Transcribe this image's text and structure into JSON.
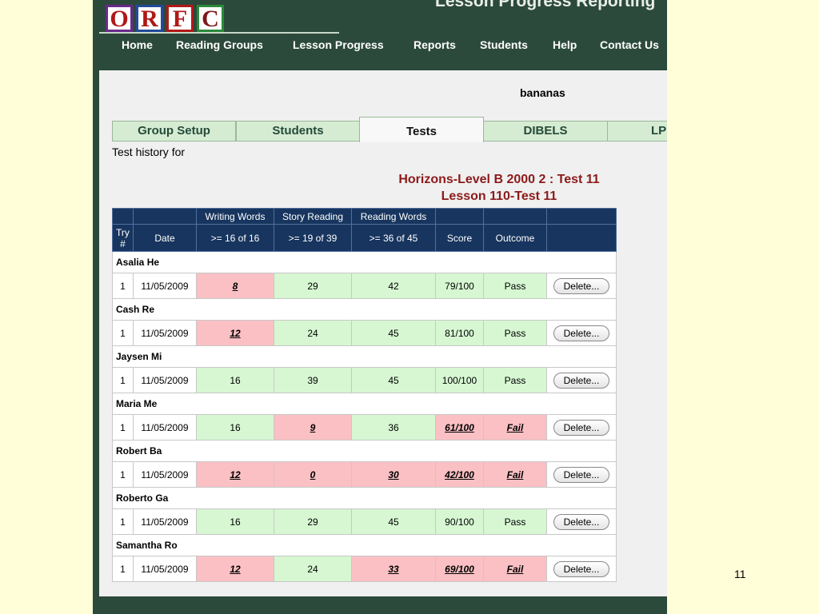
{
  "logo_letters": [
    "O",
    "R",
    "F",
    "C"
  ],
  "app_title": "Lesson Progress Reporting",
  "nav": [
    "Home",
    "Reading Groups",
    "Lesson Progress",
    "Reports",
    "Students",
    "Help",
    "Contact Us"
  ],
  "group_name": "bananas",
  "tabs": [
    "Group Setup",
    "Students",
    "Tests",
    "DIBELS",
    "LPR"
  ],
  "active_tab": "Tests",
  "history_label": "Test history for",
  "test_title": [
    "Horizons-Level B 2000 2 : Test 11",
    "Lesson 110-Test 11"
  ],
  "table": {
    "group_headers": [
      "Writing Words",
      "Story Reading",
      "Reading Words"
    ],
    "headers": [
      "Try #",
      "Date",
      ">= 16 of 16",
      ">= 19 of 39",
      ">= 36 of 45",
      "Score",
      "Outcome"
    ],
    "delete_label": "Delete...",
    "students": [
      {
        "name": "Asalia He",
        "try": "1",
        "date": "11/05/2009",
        "writing": "8",
        "writing_pass": false,
        "story": "29",
        "story_pass": true,
        "reading": "42",
        "reading_pass": true,
        "score": "79/100",
        "score_pass": true,
        "outcome": "Pass"
      },
      {
        "name": "Cash Re",
        "try": "1",
        "date": "11/05/2009",
        "writing": "12",
        "writing_pass": false,
        "story": "24",
        "story_pass": true,
        "reading": "45",
        "reading_pass": true,
        "score": "81/100",
        "score_pass": true,
        "outcome": "Pass"
      },
      {
        "name": "Jaysen Mi",
        "try": "1",
        "date": "11/05/2009",
        "writing": "16",
        "writing_pass": true,
        "story": "39",
        "story_pass": true,
        "reading": "45",
        "reading_pass": true,
        "score": "100/100",
        "score_pass": true,
        "outcome": "Pass"
      },
      {
        "name": "Maria Me",
        "try": "1",
        "date": "11/05/2009",
        "writing": "16",
        "writing_pass": true,
        "story": "9",
        "story_pass": false,
        "reading": "36",
        "reading_pass": true,
        "score": "61/100",
        "score_pass": false,
        "outcome": "Fail"
      },
      {
        "name": "Robert Ba",
        "try": "1",
        "date": "11/05/2009",
        "writing": "12",
        "writing_pass": false,
        "story": "0",
        "story_pass": false,
        "reading": "30",
        "reading_pass": false,
        "score": "42/100",
        "score_pass": false,
        "outcome": "Fail"
      },
      {
        "name": "Roberto Ga",
        "try": "1",
        "date": "11/05/2009",
        "writing": "16",
        "writing_pass": true,
        "story": "29",
        "story_pass": true,
        "reading": "45",
        "reading_pass": true,
        "score": "90/100",
        "score_pass": true,
        "outcome": "Pass"
      },
      {
        "name": "Samantha Ro",
        "try": "1",
        "date": "11/05/2009",
        "writing": "12",
        "writing_pass": false,
        "story": "24",
        "story_pass": true,
        "reading": "33",
        "reading_pass": false,
        "score": "69/100",
        "score_pass": false,
        "outcome": "Fail"
      }
    ]
  },
  "page_number": "11",
  "colors": {
    "pass": "#d6f7d2",
    "fail": "#fac0c4",
    "header": "#17355e",
    "title": "#8c1a1a",
    "app_frame": "#2c4a3c"
  }
}
